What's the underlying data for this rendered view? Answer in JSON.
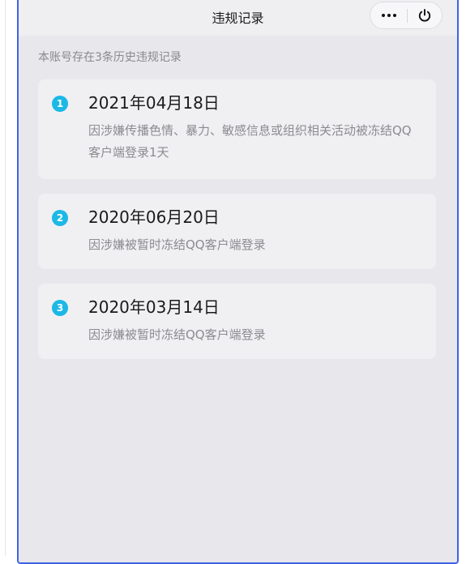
{
  "header": {
    "title": "违规记录",
    "more_icon": "more-dots-icon",
    "power_icon": "power-icon"
  },
  "notice": "本账号存在3条历史违规记录",
  "records": [
    {
      "index": "1",
      "date": "2021年04月18日",
      "description": "因涉嫌传播色情、暴力、敏感信息或组织相关活动被冻结QQ客户端登录1天"
    },
    {
      "index": "2",
      "date": "2020年06月20日",
      "description": "因涉嫌被暂时冻结QQ客户端登录"
    },
    {
      "index": "3",
      "date": "2020年03月14日",
      "description": "因涉嫌被暂时冻结QQ客户端登录"
    }
  ],
  "colors": {
    "frame_border": "#3e63e6",
    "badge": "#1cb8e6",
    "background": "#e8e8ec",
    "card": "#f0f0f3"
  }
}
